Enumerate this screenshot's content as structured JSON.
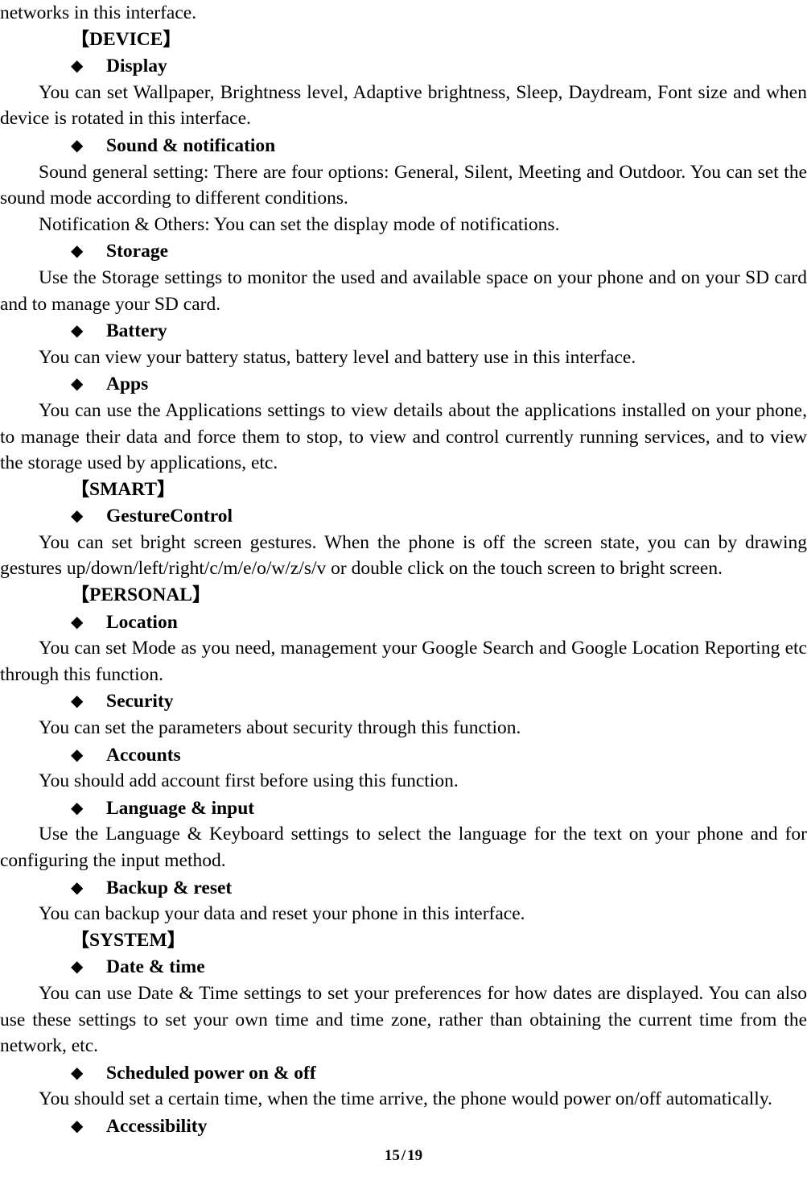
{
  "document": {
    "type": "user-manual-page",
    "page_label": "15 / 19",
    "page_number": "15",
    "page_separator": "/",
    "page_total": "19",
    "bullet_glyph": "◆",
    "bracket_open": "【",
    "bracket_close": "】"
  },
  "blocks": [
    {
      "kind": "paragraph-continuation",
      "text": "networks in this interface."
    },
    {
      "kind": "section",
      "label": "DEVICE"
    },
    {
      "kind": "subsection",
      "label": "Display"
    },
    {
      "kind": "paragraph",
      "text": "You can set Wallpaper, Brightness level, Adaptive brightness, Sleep, Daydream, Font size and when device is rotated in this interface."
    },
    {
      "kind": "subsection",
      "label": "Sound & notification"
    },
    {
      "kind": "paragraph",
      "text": "Sound general setting: There are four options: General, Silent, Meeting and Outdoor. You can set the sound mode according to different conditions."
    },
    {
      "kind": "paragraph",
      "text": "Notification & Others: You can set the display mode of notifications."
    },
    {
      "kind": "subsection",
      "label": "Storage"
    },
    {
      "kind": "paragraph",
      "text": "Use the Storage settings to monitor the used and available space on your phone and on your SD card and to manage your SD card."
    },
    {
      "kind": "subsection",
      "label": "Battery"
    },
    {
      "kind": "paragraph",
      "text": "You can view your battery status, battery level and battery use in this interface."
    },
    {
      "kind": "subsection",
      "label": "Apps"
    },
    {
      "kind": "paragraph",
      "text": "You can use the Applications settings to view details about the applications installed on your phone, to manage their data and force them to stop, to view and control currently running services, and to view the storage used by applications, etc."
    },
    {
      "kind": "section",
      "label": "SMART"
    },
    {
      "kind": "subsection",
      "label": "GestureControl"
    },
    {
      "kind": "paragraph",
      "text": "You can set bright screen gestures. When the phone is off the screen state, you can by drawing gestures up/down/left/right/c/m/e/o/w/z/s/v or double click on the touch screen to bright screen."
    },
    {
      "kind": "section",
      "label": "PERSONAL"
    },
    {
      "kind": "subsection",
      "label": "Location"
    },
    {
      "kind": "paragraph",
      "text": "You can set Mode as you need, management your Google Search and Google Location Reporting etc through this function."
    },
    {
      "kind": "subsection",
      "label": "Security"
    },
    {
      "kind": "paragraph",
      "text": "You can set the parameters about security through this function."
    },
    {
      "kind": "subsection",
      "label": "Accounts"
    },
    {
      "kind": "paragraph",
      "text": "You should add account first before using this function."
    },
    {
      "kind": "subsection",
      "label": "Language & input"
    },
    {
      "kind": "paragraph",
      "text": "Use the Language & Keyboard settings to select the language for the text on your phone and for configuring the input method."
    },
    {
      "kind": "subsection",
      "label": "Backup & reset"
    },
    {
      "kind": "paragraph",
      "text": "You can backup your data and reset your phone in this interface."
    },
    {
      "kind": "section",
      "label": "SYSTEM"
    },
    {
      "kind": "subsection",
      "label": "Date & time"
    },
    {
      "kind": "paragraph",
      "text": "You can use Date & Time settings to set your preferences for how dates are displayed. You can also use these settings to set your own time and time zone, rather than obtaining the current time from the network, etc."
    },
    {
      "kind": "subsection",
      "label": "Scheduled power on & off"
    },
    {
      "kind": "paragraph",
      "text": "You should set a certain time, when the time arrive, the phone would power on/off automatically."
    },
    {
      "kind": "subsection",
      "label": "Accessibility"
    }
  ]
}
